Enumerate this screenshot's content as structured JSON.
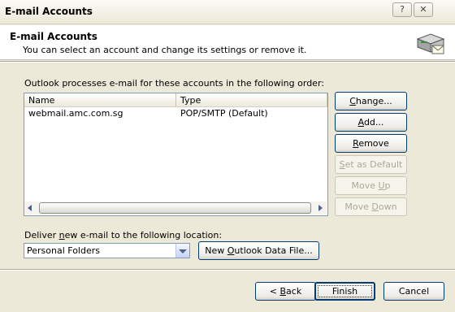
{
  "window": {
    "title": "E-mail Accounts",
    "help_label": "?",
    "close_label": "✕"
  },
  "header": {
    "title": "E-mail Accounts",
    "description": "You can select an account and change its settings or remove it."
  },
  "accounts": {
    "heading": "Outlook processes e-mail for these accounts in the following order:",
    "columns": [
      "Name",
      "Type"
    ],
    "rows": [
      {
        "name": "webmail.amc.com.sg",
        "type": "POP/SMTP (Default)"
      }
    ]
  },
  "side_buttons": {
    "change": {
      "pre": "",
      "key": "C",
      "post": "hange..."
    },
    "add": {
      "pre": "",
      "key": "A",
      "post": "dd..."
    },
    "remove": {
      "pre": "",
      "key": "R",
      "post": "emove"
    },
    "set_default": {
      "pre": "",
      "key": "S",
      "post": "et as Default"
    },
    "move_up": {
      "pre": "Move ",
      "key": "U",
      "post": "p"
    },
    "move_down": {
      "pre": "Move ",
      "key": "D",
      "post": "own"
    }
  },
  "deliver": {
    "label_pre": "Deliver ",
    "label_key": "n",
    "label_post": "ew e-mail to the following location:",
    "selected": "Personal Folders",
    "new_file": {
      "pre": "New ",
      "key": "O",
      "post": "utlook Data File..."
    }
  },
  "footer": {
    "back": {
      "pre": "< ",
      "key": "B",
      "post": "ack"
    },
    "finish": "Finish",
    "cancel": "Cancel"
  }
}
